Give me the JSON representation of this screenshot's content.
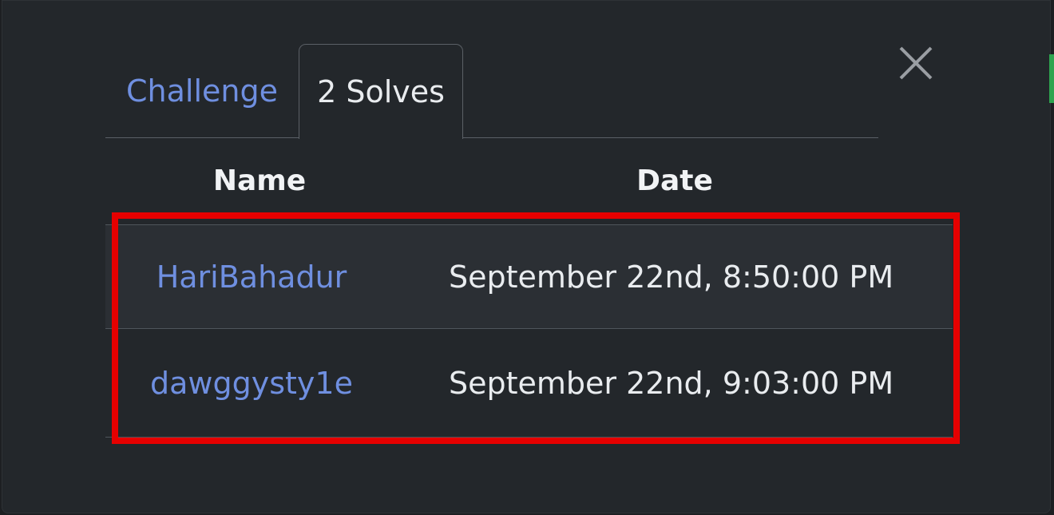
{
  "tabs": [
    {
      "label": "Challenge",
      "active": false
    },
    {
      "label": "2 Solves",
      "active": true
    }
  ],
  "table": {
    "headers": {
      "name": "Name",
      "date": "Date"
    },
    "rows": [
      {
        "name": "HariBahadur",
        "date": "September 22nd, 8:50:00 PM"
      },
      {
        "name": "dawggysty1e",
        "date": "September 22nd, 9:03:00 PM"
      }
    ]
  },
  "icons": {
    "close": "close-icon"
  },
  "colors": {
    "background": "#23272b",
    "link": "#6f8fe0",
    "text": "#e9ecef",
    "highlight": "#e50000",
    "accent": "#2ea44f"
  }
}
